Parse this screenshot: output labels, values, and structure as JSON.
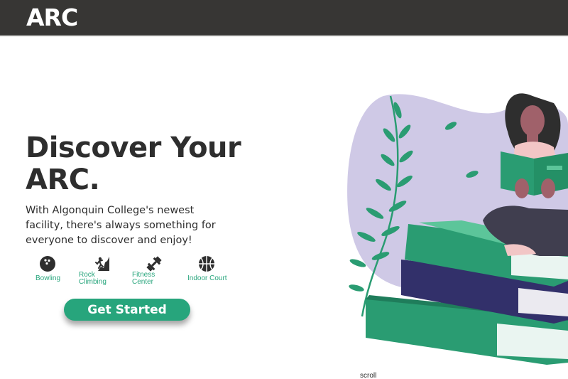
{
  "header": {
    "logo_text": "ARC"
  },
  "hero": {
    "title_line1": "Discover Your",
    "title_line2": "ARC.",
    "subtitle": "With Algonquin College's newest facility, there's always something for everyone to discover and enjoy!"
  },
  "facilities": [
    {
      "label_1": "Bowling",
      "label_2": "",
      "icon": "bowling-ball-icon"
    },
    {
      "label_1": "Rock",
      "label_2": "Climbing",
      "icon": "rock-climbing-icon"
    },
    {
      "label_1": "Fitness",
      "label_2": "Center",
      "icon": "dumbbell-icon"
    },
    {
      "label_1": "Indoor Court",
      "label_2": "",
      "icon": "basketball-icon"
    }
  ],
  "cta": {
    "label": "Get Started"
  },
  "scroll": {
    "label": "scroll"
  },
  "colors": {
    "header_bg": "#373634",
    "accent_green": "#27a57c",
    "book_green": "#2a9c72",
    "book_navy": "#32306a",
    "blob_lavender": "#cfc9e6",
    "text_dark": "#2e2e2e"
  }
}
